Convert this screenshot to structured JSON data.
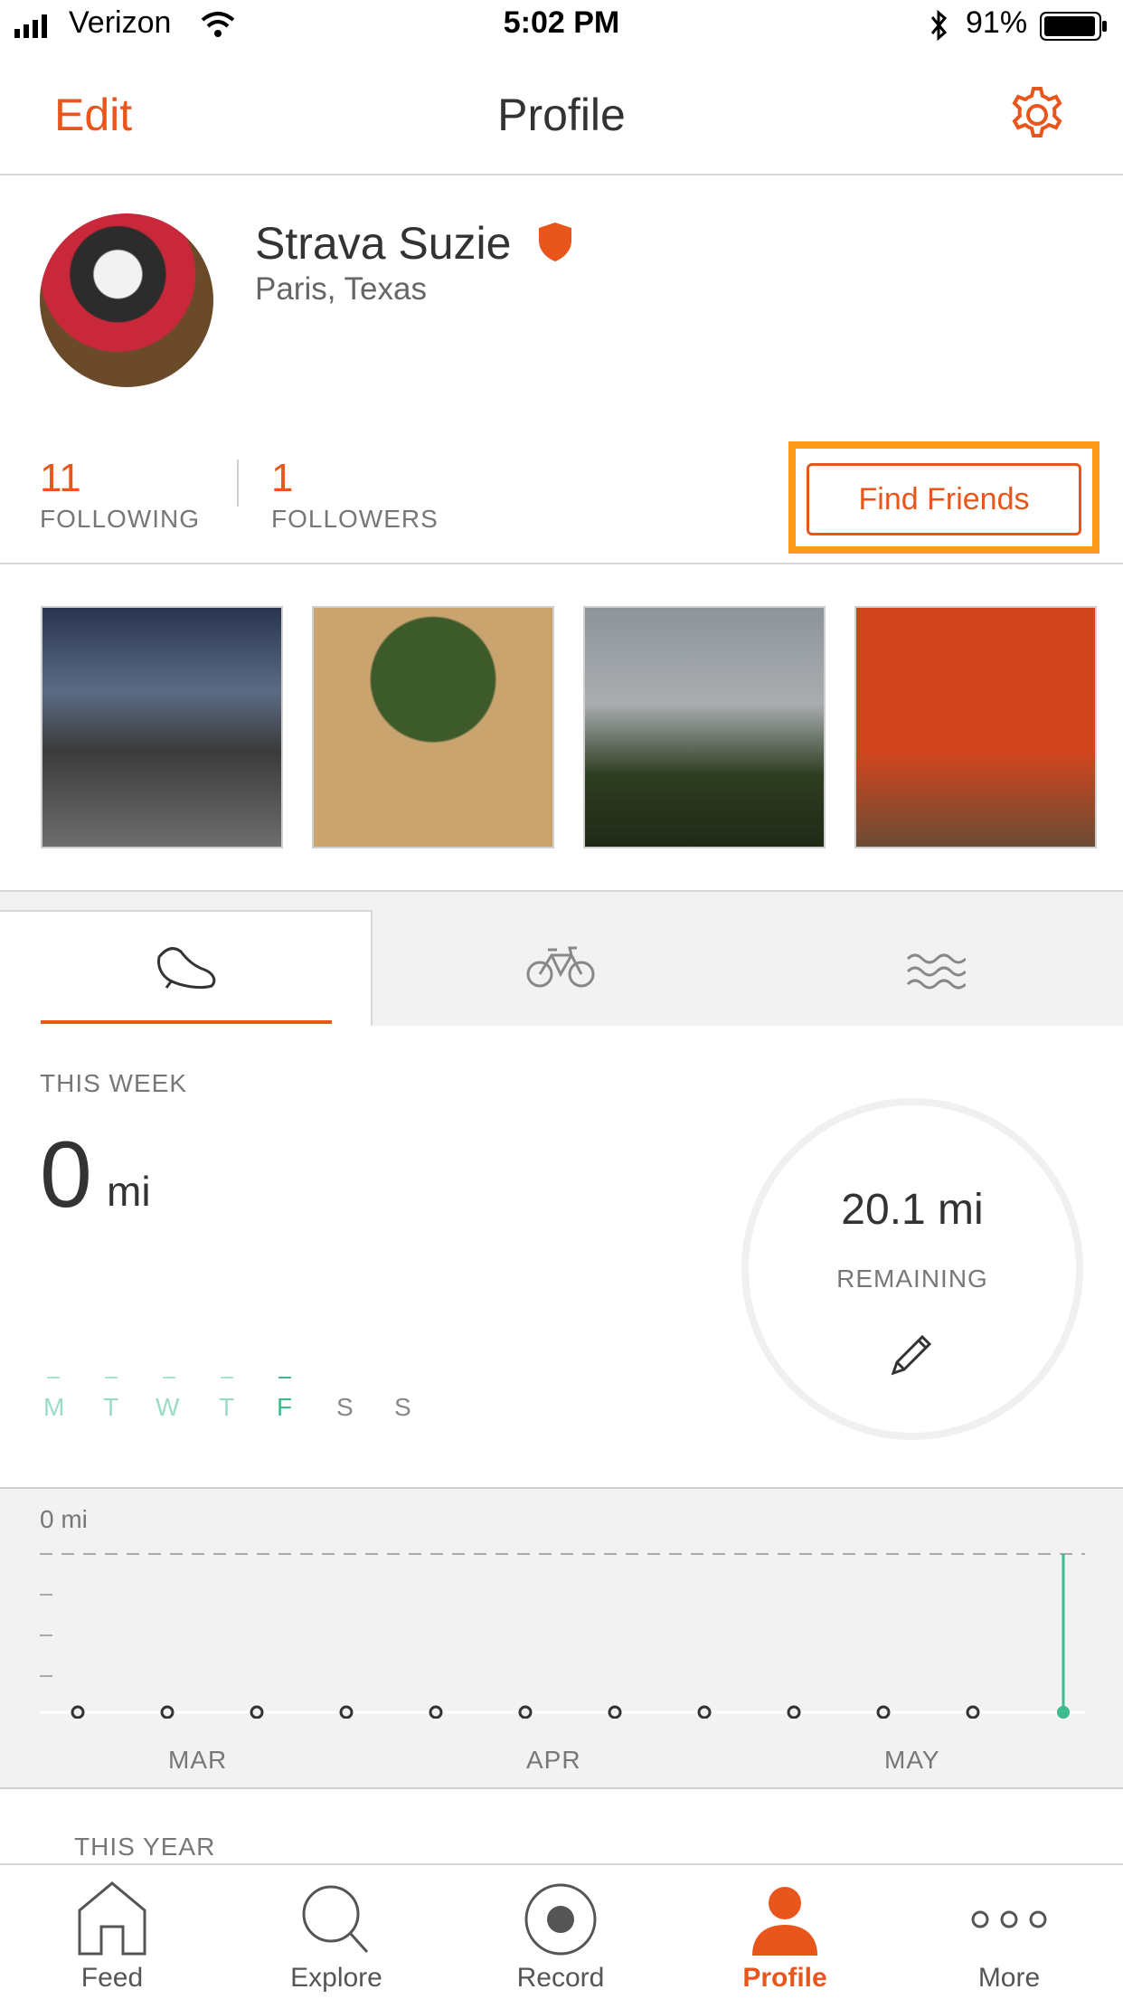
{
  "status_bar": {
    "carrier": "Verizon",
    "time": "5:02 PM",
    "battery": "91%"
  },
  "nav": {
    "edit": "Edit",
    "title": "Profile"
  },
  "profile": {
    "name": "Strava Suzie",
    "location": "Paris, Texas"
  },
  "stats": {
    "following_count": "11",
    "following_label": "FOLLOWING",
    "followers_count": "1",
    "followers_label": "FOLLOWERS",
    "find_friends": "Find Friends"
  },
  "activity_tabs": [
    "run-icon",
    "bike-icon",
    "swim-icon"
  ],
  "this_week": {
    "label": "THIS WEEK",
    "distance": "0",
    "unit": "mi",
    "days": [
      "M",
      "T",
      "W",
      "T",
      "F",
      "S",
      "S"
    ],
    "remaining_value": "20.1 mi",
    "remaining_label": "REMAINING"
  },
  "chart": {
    "ylabel": "0 mi",
    "months": [
      "MAR",
      "APR",
      "MAY"
    ]
  },
  "this_year": {
    "label": "THIS YEAR"
  },
  "tabbar": {
    "items": [
      {
        "label": "Feed",
        "icon": "home-icon"
      },
      {
        "label": "Explore",
        "icon": "search-icon"
      },
      {
        "label": "Record",
        "icon": "record-icon"
      },
      {
        "label": "Profile",
        "icon": "profile-icon"
      },
      {
        "label": "More",
        "icon": "more-icon"
      }
    ]
  },
  "colors": {
    "accent": "#e8561b",
    "highlight": "#ff9a1a",
    "goal_green": "#3dbb8a"
  }
}
